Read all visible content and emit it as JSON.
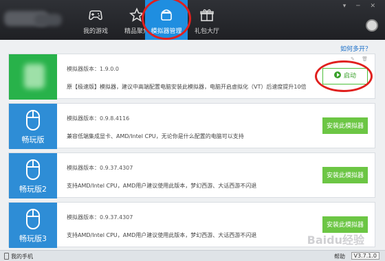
{
  "header": {
    "nav": [
      {
        "label": "我的游戏",
        "icon": "gamepad-icon"
      },
      {
        "label": "精品聚焦",
        "icon": "star-icon"
      },
      {
        "label": "模拟器管理",
        "icon": "android-icon"
      },
      {
        "label": "礼包大厅",
        "icon": "gift-icon"
      }
    ],
    "window_buttons": "▾ ─ ✕"
  },
  "help_link": "如何多开？",
  "cards": [
    {
      "thumb_label": "",
      "version": "模拟器版本：1.9.0.0",
      "description": "原【极速版】模拟器，建议中高端配置电脑安装此模拟器，电脑开启虚拟化（VT）后速度提升10倍",
      "button": "启动",
      "mini_icons": "✎ 🗑"
    },
    {
      "thumb_label": "畅玩版",
      "version": "模拟器版本：0.9.8.4116",
      "description": "兼容低端集成显卡、AMD/Intel CPU，无论你是什么配置的电脑可以支持",
      "button": "安装此模拟器"
    },
    {
      "thumb_label": "畅玩版2",
      "version": "模拟器版本：0.9.37.4307",
      "description": "支持AMD/Intel CPU，AMD用户建议使用此版本，梦幻西游、大话西游不闪退",
      "button": "安装此模拟器"
    },
    {
      "thumb_label": "畅玩版3",
      "version": "模拟器版本：0.9.37.4307",
      "description": "支持AMD/Intel CPU，AMD用户建议使用此版本，梦幻西游、大话西游不闪退",
      "button": "安装此模拟器"
    }
  ],
  "footer": {
    "phone": "我的手机",
    "help": "帮助",
    "version": "V3.7.1.0"
  },
  "watermark": "Baidu经验",
  "colors": {
    "header_bg": "#26282c",
    "active_tab": "#1f8ee0",
    "green": "#28b24a",
    "blue": "#2e8dd6",
    "install_btn": "#6cc644",
    "annotation": "#e0201e"
  }
}
